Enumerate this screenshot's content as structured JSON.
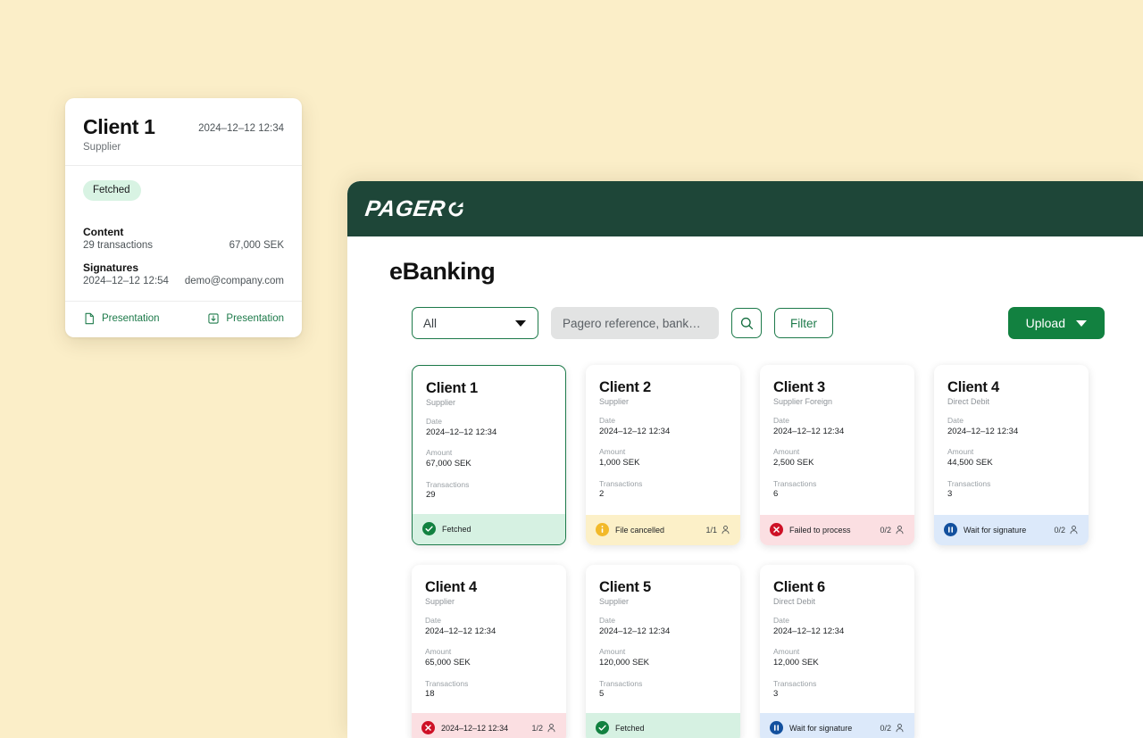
{
  "theme": {
    "page_background": "#fbeec8",
    "brand_dark_green": "#1e4638",
    "brand_green": "#128140",
    "accent_green": "#1d7a4a"
  },
  "detail_panel": {
    "title": "Client 1",
    "subtitle": "Supplier",
    "date": "2024–12–12  12:34",
    "status_badge": "Fetched",
    "content_label": "Content",
    "content_value": "29 transactions",
    "content_amount": "67,000 SEK",
    "signatures_label": "Signatures",
    "signature_date": "2024–12–12  12:54",
    "signature_email": "demo@company.com",
    "footer": {
      "left_label": "Presentation",
      "left_icon": "document-icon",
      "right_label": "Presentation",
      "right_icon": "download-icon"
    }
  },
  "app": {
    "logo_text": "PAGER",
    "logo_mark": "pagero-o-mark",
    "page_title": "eBanking",
    "toolbar": {
      "select_value": "All",
      "select_icon": "chevron-down-icon",
      "search_placeholder": "Pagero reference, bank…",
      "search_value": "",
      "search_icon": "search-icon",
      "filter_label": "Filter",
      "upload_label": "Upload",
      "upload_icon": "chevron-down-icon"
    },
    "labels": {
      "date": "Date",
      "amount": "Amount",
      "transactions": "Transactions"
    },
    "cards": [
      {
        "title": "Client 1",
        "subtitle": "Supplier",
        "date": "2024–12–12  12:34",
        "amount": "67,000 SEK",
        "transactions": "29",
        "status_text": "Fetched",
        "status_type": "green",
        "status_icon": "check-circle-icon",
        "count": "",
        "selected": true
      },
      {
        "title": "Client 2",
        "subtitle": "Supplier",
        "date": "2024–12–12  12:34",
        "amount": "1,000 SEK",
        "transactions": "2",
        "status_text": "File cancelled",
        "status_type": "yellow",
        "status_icon": "info-circle-icon",
        "count": "1/1",
        "selected": false
      },
      {
        "title": "Client 3",
        "subtitle": "Supplier Foreign",
        "date": "2024–12–12  12:34",
        "amount": "2,500 SEK",
        "transactions": "6",
        "status_text": "Failed to process",
        "status_type": "red",
        "status_icon": "x-circle-icon",
        "count": "0/2",
        "selected": false
      },
      {
        "title": "Client 4",
        "subtitle": "Direct Debit",
        "date": "2024–12–12  12:34",
        "amount": "44,500 SEK",
        "transactions": "3",
        "status_text": "Wait for signature",
        "status_type": "blue",
        "status_icon": "pause-circle-icon",
        "count": "0/2",
        "selected": false
      },
      {
        "title": "Client 4",
        "subtitle": "Supplier",
        "date": "2024–12–12  12:34",
        "amount": "65,000 SEK",
        "transactions": "18",
        "status_text": "2024–12–12  12:34",
        "status_type": "red",
        "status_icon": "x-circle-icon",
        "count": "1/2",
        "selected": false
      },
      {
        "title": "Client 5",
        "subtitle": "Supplier",
        "date": "2024–12–12  12:34",
        "amount": "120,000 SEK",
        "transactions": "5",
        "status_text": "Fetched",
        "status_type": "green",
        "status_icon": "check-circle-icon",
        "count": "",
        "selected": false
      },
      {
        "title": "Client 6",
        "subtitle": "Direct Debit",
        "date": "2024–12–12  12:34",
        "amount": "12,000 SEK",
        "transactions": "3",
        "status_text": "Wait for signature",
        "status_type": "blue",
        "status_icon": "pause-circle-icon",
        "count": "0/2",
        "selected": false
      }
    ]
  }
}
